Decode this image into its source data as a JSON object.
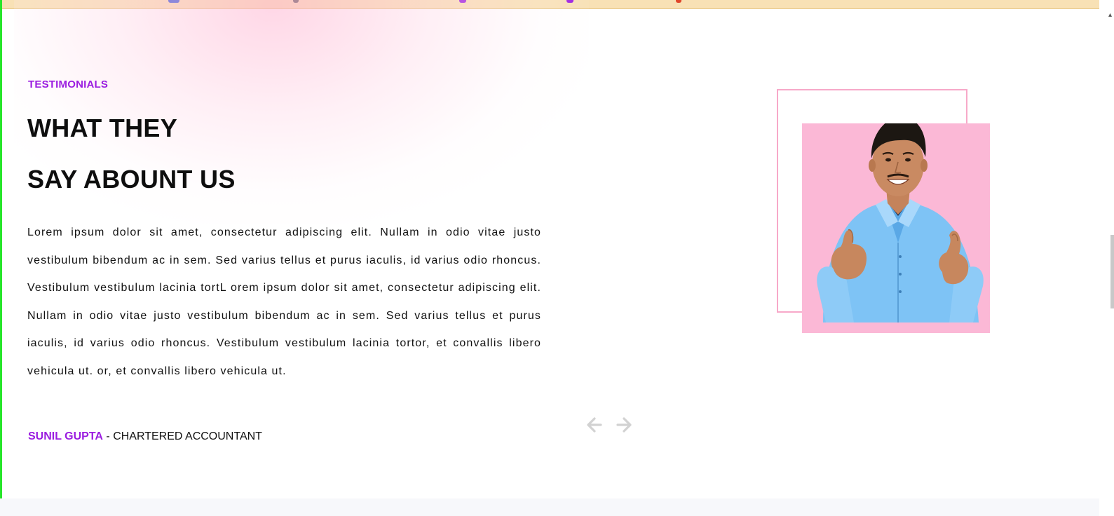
{
  "colors": {
    "accent": "#9b1de0",
    "pink_frame": "#f7a9c9",
    "pink_photo_bg": "#fbb8d6",
    "shirt": "#7ec3f5",
    "arrows": "#d2d2d2"
  },
  "section": {
    "eyebrow": "TESTIMONIALS",
    "headline_line1": "WHAT THEY",
    "headline_line2": "SAY ABOUNT US",
    "quote": "Lorem ipsum dolor sit amet, consectetur adipiscing elit. Nullam in odio vitae justo vestibulum bibendum ac in sem. Sed varius tellus et purus iaculis, id varius odio rhoncus. Vestibulum vestibulum lacinia tortL orem ipsum dolor sit amet, consectetur adipiscing elit. Nullam in odio vitae justo vestibulum bibendum ac in sem. Sed varius tellus et purus iaculis, id varius odio rhoncus. Vestibulum vestibulum lacinia tortor, et convallis libero vehicula ut. or, et convallis libero vehicula ut.",
    "author_name": "SUNIL GUPTA",
    "author_separator": " - ",
    "author_title": "CHARTERED ACCOUNTANT"
  },
  "navigation": {
    "prev_icon": "arrow-left-icon",
    "next_icon": "arrow-right-icon"
  },
  "photo": {
    "subject": "smiling man giving two thumbs up"
  }
}
